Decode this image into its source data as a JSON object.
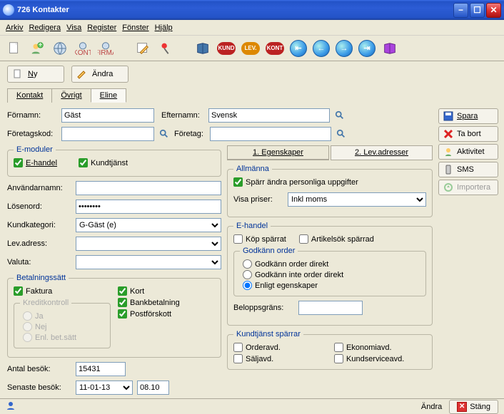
{
  "window": {
    "title": "726 Kontakter"
  },
  "menu": {
    "arkiv": "Arkiv",
    "redigera": "Redigera",
    "visa": "Visa",
    "register": "Register",
    "fonster": "Fönster",
    "hjalp": "Hjälp"
  },
  "actions": {
    "ny": "Ny",
    "andra": "Ändra"
  },
  "tabs": {
    "kontakt": "Kontakt",
    "ovrigt": "Övrigt",
    "eline": "Eline"
  },
  "form": {
    "fornamn_label": "Förnamn:",
    "fornamn": "Gäst",
    "efternamn_label": "Efternamn:",
    "efternamn": "Svensk",
    "foretagskod_label": "Företagskod:",
    "foretag_label": "Företag:"
  },
  "emod": {
    "legend": "E-moduler",
    "ehandel": "E-handel",
    "kundtjanst": "Kundtjänst",
    "anvandarnamn": "Användarnamn:",
    "losenord": "Lösenord:",
    "kundkategori_label": "Kundkategori:",
    "kundkategori": "G-Gäst (e)",
    "levadress": "Lev.adress:",
    "valuta": "Valuta:"
  },
  "betal": {
    "legend": "Betalningssätt",
    "faktura": "Faktura",
    "kort": "Kort",
    "bank": "Bankbetalning",
    "post": "Postförskott",
    "kredit_legend": "Kreditkontroll",
    "ja": "Ja",
    "nej": "Nej",
    "enl": "Enl. bet.sätt"
  },
  "visits": {
    "antal_label": "Antal besök:",
    "antal": "15431",
    "senaste_label": "Senaste besök:",
    "senaste_date": "11-01-13",
    "senaste_time": "08.10"
  },
  "propTabs": {
    "egenskaper": "1.  Egenskaper",
    "levadresser": "2.  Lev.adresser"
  },
  "allmanna": {
    "legend": "Allmänna",
    "sparr": "Spärr ändra personliga uppgifter",
    "visapriser_label": "Visa priser:",
    "visapriser": "Inkl moms"
  },
  "ehandelProps": {
    "legend": "E-handel",
    "kopsparrat": "Köp spärrat",
    "artikelsok": "Artikelsök spärrad",
    "godkann_legend": "Godkänn order",
    "r1": "Godkänn order direkt",
    "r2": "Godkänn inte order direkt",
    "r3": "Enligt egenskaper",
    "beloppsgrans": "Beloppsgräns:"
  },
  "kundsparr": {
    "legend": "Kundtjänst spärrar",
    "orderavd": "Orderavd.",
    "ekonomiavd": "Ekonomiavd.",
    "saljavd": "Säljavd.",
    "kundservice": "Kundserviceavd."
  },
  "side": {
    "spara": "Spara",
    "tabort": "Ta bort",
    "aktivitet": "Aktivitet",
    "sms": "SMS",
    "importera": "Importera"
  },
  "status": {
    "andra": "Ändra",
    "stang": "Stäng"
  }
}
